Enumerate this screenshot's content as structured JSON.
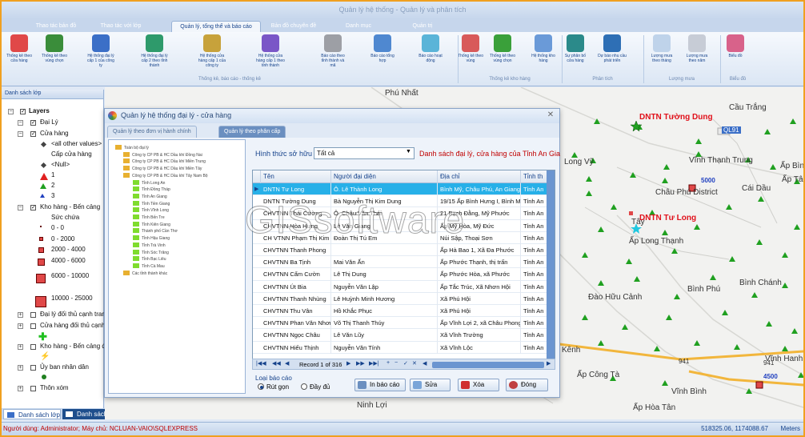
{
  "app": {
    "title": "Quản lý hệ thống - Quản lý và phân tích"
  },
  "ribbon": {
    "tabs": [
      {
        "label": "Thao tác bản đồ"
      },
      {
        "label": "Thao tác với lớp"
      },
      {
        "label": "Quản lý, tổng thể và báo cáo",
        "selected": true
      },
      {
        "label": "Bản đồ chuyên đề"
      },
      {
        "label": "Danh mục"
      },
      {
        "label": "Quản trị"
      }
    ],
    "buttons": [
      {
        "label": "Thống kê theo cửa hàng",
        "color": "#e04848"
      },
      {
        "label": "Thống kê theo vùng chọn",
        "color": "#3a8d3a"
      },
      {
        "label": "Hệ thống đại lý cấp 1 của công ty",
        "color": "#3b6fc7"
      },
      {
        "label": "Hệ thống đại lý cấp 2 theo tỉnh thành",
        "color": "#2e9a6b"
      },
      {
        "label": "Hệ thống cửa hàng cấp 1 của công ty",
        "color": "#c7a23b"
      },
      {
        "label": "Hệ thống cửa hàng cấp 1 theo tỉnh thành",
        "color": "#7a56c7"
      },
      {
        "label": "Báo cáo theo tỉnh thành và mã",
        "color": "#9d9fa5"
      },
      {
        "label": "Báo cáo tổng hợp",
        "color": "#4f88d0"
      },
      {
        "label": "Báo cáo hoạt động",
        "color": "#5ab4d8"
      },
      {
        "label": "Thống kê theo vùng",
        "color": "#d85a5a"
      },
      {
        "label": "Thống kê theo vùng chọn",
        "color": "#3aa03a"
      },
      {
        "label": "Hệ thống kho hàng",
        "color": "#6a9ad8"
      },
      {
        "label": "Sự phân bố cửa hàng",
        "color": "#2b8a8a"
      },
      {
        "label": "Dự báo nhu cầu phát triển",
        "color": "#2e6fb5"
      },
      {
        "label": "Lượng mưa theo tháng",
        "color": "#bfd3ea"
      },
      {
        "label": "Lượng mưa theo năm",
        "color": "#c7ccd6"
      },
      {
        "label": "Biểu đồ",
        "color": "#d8628a"
      }
    ],
    "groups": [
      {
        "label": "Thống kê, báo cáo - thống kê"
      },
      {
        "label": "Thống kê kho hàng"
      },
      {
        "label": "Phân tích"
      },
      {
        "label": "Lượng mưa"
      },
      {
        "label": "Biểu đồ"
      }
    ]
  },
  "left_panel": {
    "title": "Danh sách lớp",
    "layers_root": "Layers",
    "items": [
      {
        "label": "Đại Lý"
      },
      {
        "label": "Cửa hàng"
      },
      {
        "label": "<all other values>"
      },
      {
        "label": "Cấp cửa hàng"
      },
      {
        "label": "<Null>"
      },
      {
        "label": "1"
      },
      {
        "label": "2"
      },
      {
        "label": "3"
      },
      {
        "label": "Kho hàng - Bến cảng"
      },
      {
        "label": "Sức chứa"
      },
      {
        "label": "0 - 0"
      },
      {
        "label": "0 - 2000"
      },
      {
        "label": "2000 - 4000"
      },
      {
        "label": "4000 - 6000"
      },
      {
        "label": "6000 - 10000"
      },
      {
        "label": "10000 - 25000"
      },
      {
        "label": "Đại lý đối thủ cạnh tranh"
      },
      {
        "label": "Cửa hàng đối thủ cạnh tranh"
      },
      {
        "label": "Kho hàng - Bến cảng đối thủ"
      },
      {
        "label": "Ủy ban nhân dân"
      },
      {
        "label": "Thôn xóm"
      }
    ],
    "tabs": [
      {
        "label": "Danh sách lớp"
      },
      {
        "label": "Danh sách chọn lớp"
      }
    ]
  },
  "map": {
    "labels": [
      "Phú Nhất",
      "Long Vỹ",
      "Vĩnh Thạnh Trung",
      "Cái Dầu",
      "Ấp Bình",
      "Ấp Tân",
      "Châu Phú District",
      "Tây",
      "Ấp Long Thạnh",
      "Bình Phú",
      "Bình Chánh",
      "Đào Hữu Cảnh",
      "Ấp Kênh",
      "Vĩnh Hanh",
      "Ấp Công Tà",
      "Vĩnh Bình",
      "Ninh Lợi",
      "Ấp Hòa Tân",
      "Cầu Trắng"
    ],
    "red_labels": [
      "DNTN Tường Dung",
      "DNTN Tư Long"
    ],
    "road_labels": [
      "QL91",
      "941",
      "941"
    ],
    "number_labels": [
      "5000",
      "4500"
    ]
  },
  "dialog": {
    "title": "Quản lý hệ thống đại lý - cửa hàng",
    "tabs": [
      {
        "label": "Quản lý theo đơn vị hành chính"
      },
      {
        "label": "Quản lý theo phân cấp"
      }
    ],
    "tree": {
      "root": "Toàn bộ đại lý",
      "companies": [
        "Công ty CP PB & HC Dầu khí Đồng Nai",
        "Công ty CP PB & HC Dầu khí Miền Trung",
        "Công ty CP PB & HC Dầu khí Miền Tây",
        "Công ty CP PB & HC Dầu khí Tây Nam Bộ"
      ],
      "provinces": [
        "Tỉnh Long An",
        "Tỉnh Đồng Tháp",
        "Tỉnh An Giang",
        "Tỉnh Tiền Giang",
        "Tỉnh Vĩnh Long",
        "Tỉnh Bến Tre",
        "Tỉnh Kiên Giang",
        "Thành phố Cần Thơ",
        "Tỉnh Hậu Giang",
        "Tỉnh Trà Vinh",
        "Tỉnh Sóc Trăng",
        "Tỉnh Bạc Liêu",
        "Tỉnh Cà Mau"
      ],
      "last": "Các tỉnh thành khác"
    },
    "filter_label": "Hình thức sở hữu",
    "filter_value": "Tất cả",
    "info": "Danh sách đại lý, cửa hàng của Tỉnh An Giang",
    "columns": [
      "Tên",
      "Người đại diện",
      "Địa chỉ",
      "Tỉnh th"
    ],
    "rows": [
      [
        "DNTN Tư Long",
        "Ô. Lê Thành Long",
        "Bình Mỹ, Châu Phú, An Giang",
        "Tỉnh An"
      ],
      [
        "DNTN Tường Dung",
        "Bà Nguyễn Thị Kim Dung",
        "19/15 Ấp Bình Hưng I, Bình Mỹ",
        "Tỉnh An"
      ],
      [
        "CHVTNN Thái Cường",
        "Ô. Châu Văn Thái",
        "21 Bạch Đằng, Mỹ Phước",
        "Tỉnh An"
      ],
      [
        "CHVTNN Hòa Hưng",
        "Lê Văn Giang",
        "Ấp Mỹ Hòa, Mỹ Đức",
        "Tỉnh An"
      ],
      [
        "CH VTNN Phạm Thị Kim Em",
        "Đoàn Thị Tú Em",
        "Núi Sập, Thoại Sơn",
        "Tỉnh An"
      ],
      [
        "CHVTNN Thanh Phong",
        "",
        "Ấp Hà Bao 1, Xã Đa Phước",
        "Tỉnh An"
      ],
      [
        "CHVTNN Ba Tịnh",
        "Mai Văn Ấn",
        "Ấp Phước Thạnh, thị trấn",
        "Tỉnh An"
      ],
      [
        "CHVTNN Cẩm Cườn",
        "Lê Thị Dung",
        "Ấp Phước Hòa, xã Phước",
        "Tỉnh An"
      ],
      [
        "CHVTNN Út Bia",
        "Nguyễn Văn Lập",
        "Ấp Tắc Trúc, Xã Nhơn Hội",
        "Tỉnh An"
      ],
      [
        "CHVTNN Thanh Nhùng",
        "Lê Huỳnh Minh Hương",
        "Xã Phú Hội",
        "Tỉnh An"
      ],
      [
        "CHVTNN Thu Vân",
        "Hồ Khắc Phục",
        "Xã Phú Hội",
        "Tỉnh An"
      ],
      [
        "CHVTNN Phan Văn Nhơn",
        "Võ Thị Thanh Thúy",
        "Ấp Vĩnh Lợi 2, xã Châu Phong",
        "Tỉnh An"
      ],
      [
        "CHVTNN Ngọc Châu",
        "Lê Văn Lũy",
        "Xã Vĩnh Trường",
        "Tỉnh An"
      ],
      [
        "CHVTNN Hiếu Thịnh",
        "Nguyễn Văn Tính",
        "Xã Vĩnh Lộc",
        "Tỉnh An"
      ]
    ],
    "record": "Record 1 of 316",
    "report_type_label": "Loại báo cáo",
    "radio": [
      {
        "label": "Rút gọn",
        "checked": true
      },
      {
        "label": "Đầy đủ",
        "checked": false
      }
    ],
    "buttons": {
      "print": "In báo cáo",
      "edit": "Sửa",
      "delete": "Xóa",
      "close": "Đóng"
    }
  },
  "watermark": "GISsoftware",
  "status": {
    "user": "Người dùng: Administrator; Máy chủ: NCLUAN-VAIO\\SQLEXPRESS",
    "coords": "518325.06, 1174088.67",
    "unit": "Meters"
  }
}
